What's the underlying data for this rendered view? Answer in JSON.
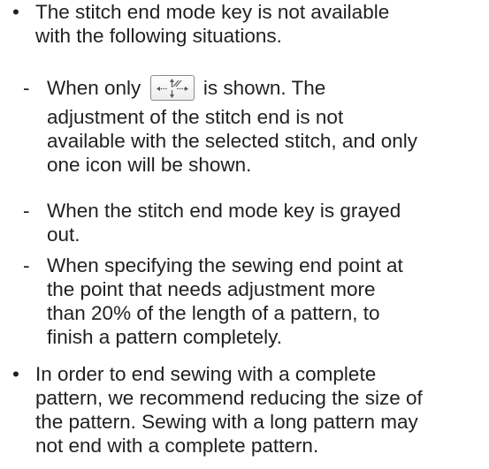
{
  "header_cut": "",
  "bullets": [
    {
      "marker": "•",
      "lines": [
        "The stitch end mode key is not available",
        "with the following situations."
      ]
    },
    {
      "marker": "•",
      "lines": [
        "In order to end sewing with a complete",
        "pattern, we recommend reducing the size of",
        "the pattern. Sewing with a long pattern may",
        "not end with a complete pattern."
      ]
    }
  ],
  "subitems": [
    {
      "marker": "-",
      "first_before": "When only",
      "first_after": "is shown. The",
      "lines": [
        "adjustment of the stitch end is not",
        "available with the selected stitch, and only",
        "one icon will be shown."
      ]
    },
    {
      "marker": "-",
      "lines": [
        "When the stitch end mode key is grayed",
        "out."
      ]
    },
    {
      "marker": "-",
      "lines": [
        "When specifying the sewing end point at",
        "the point that needs adjustment more",
        "than 20% of the length of a pattern, to",
        "finish a pattern completely."
      ]
    }
  ],
  "icons": {
    "stitch_end_key": "stitch-end-mode-key-icon"
  }
}
